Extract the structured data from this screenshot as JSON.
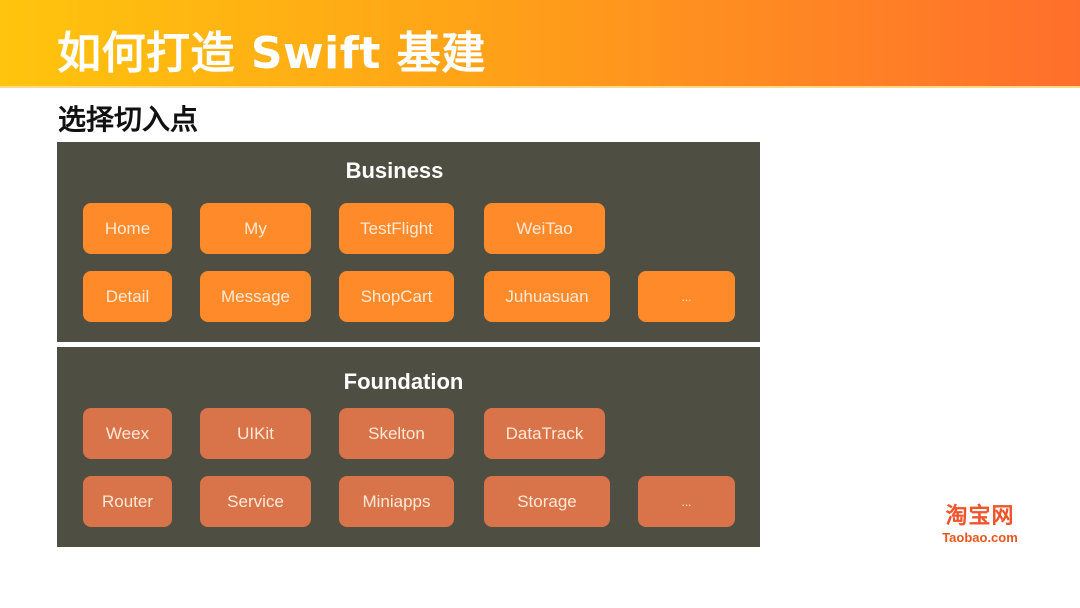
{
  "header": {
    "title": "如何打造 Swift 基建"
  },
  "subtitle": "选择切入点",
  "colors": {
    "header_gradient_start": "#FFC40D",
    "header_gradient_end": "#FF6F2C",
    "panel_bg": "#4F4E43",
    "business_box": "#FF8A2A",
    "foundation_box": "#D9734A",
    "logo": "#F0542A"
  },
  "layers": [
    {
      "name": "Business",
      "rows": [
        [
          "Home",
          "My",
          "TestFlight",
          "WeiTao"
        ],
        [
          "Detail",
          "Message",
          "ShopCart",
          "Juhuasuan",
          "..."
        ]
      ]
    },
    {
      "name": "Foundation",
      "rows": [
        [
          "Weex",
          "UIKit",
          "Skelton",
          "DataTrack"
        ],
        [
          "Router",
          "Service",
          "Miniapps",
          "Storage",
          "..."
        ]
      ]
    }
  ],
  "logo": {
    "cn": "淘宝网",
    "en": "Taobao.com"
  }
}
